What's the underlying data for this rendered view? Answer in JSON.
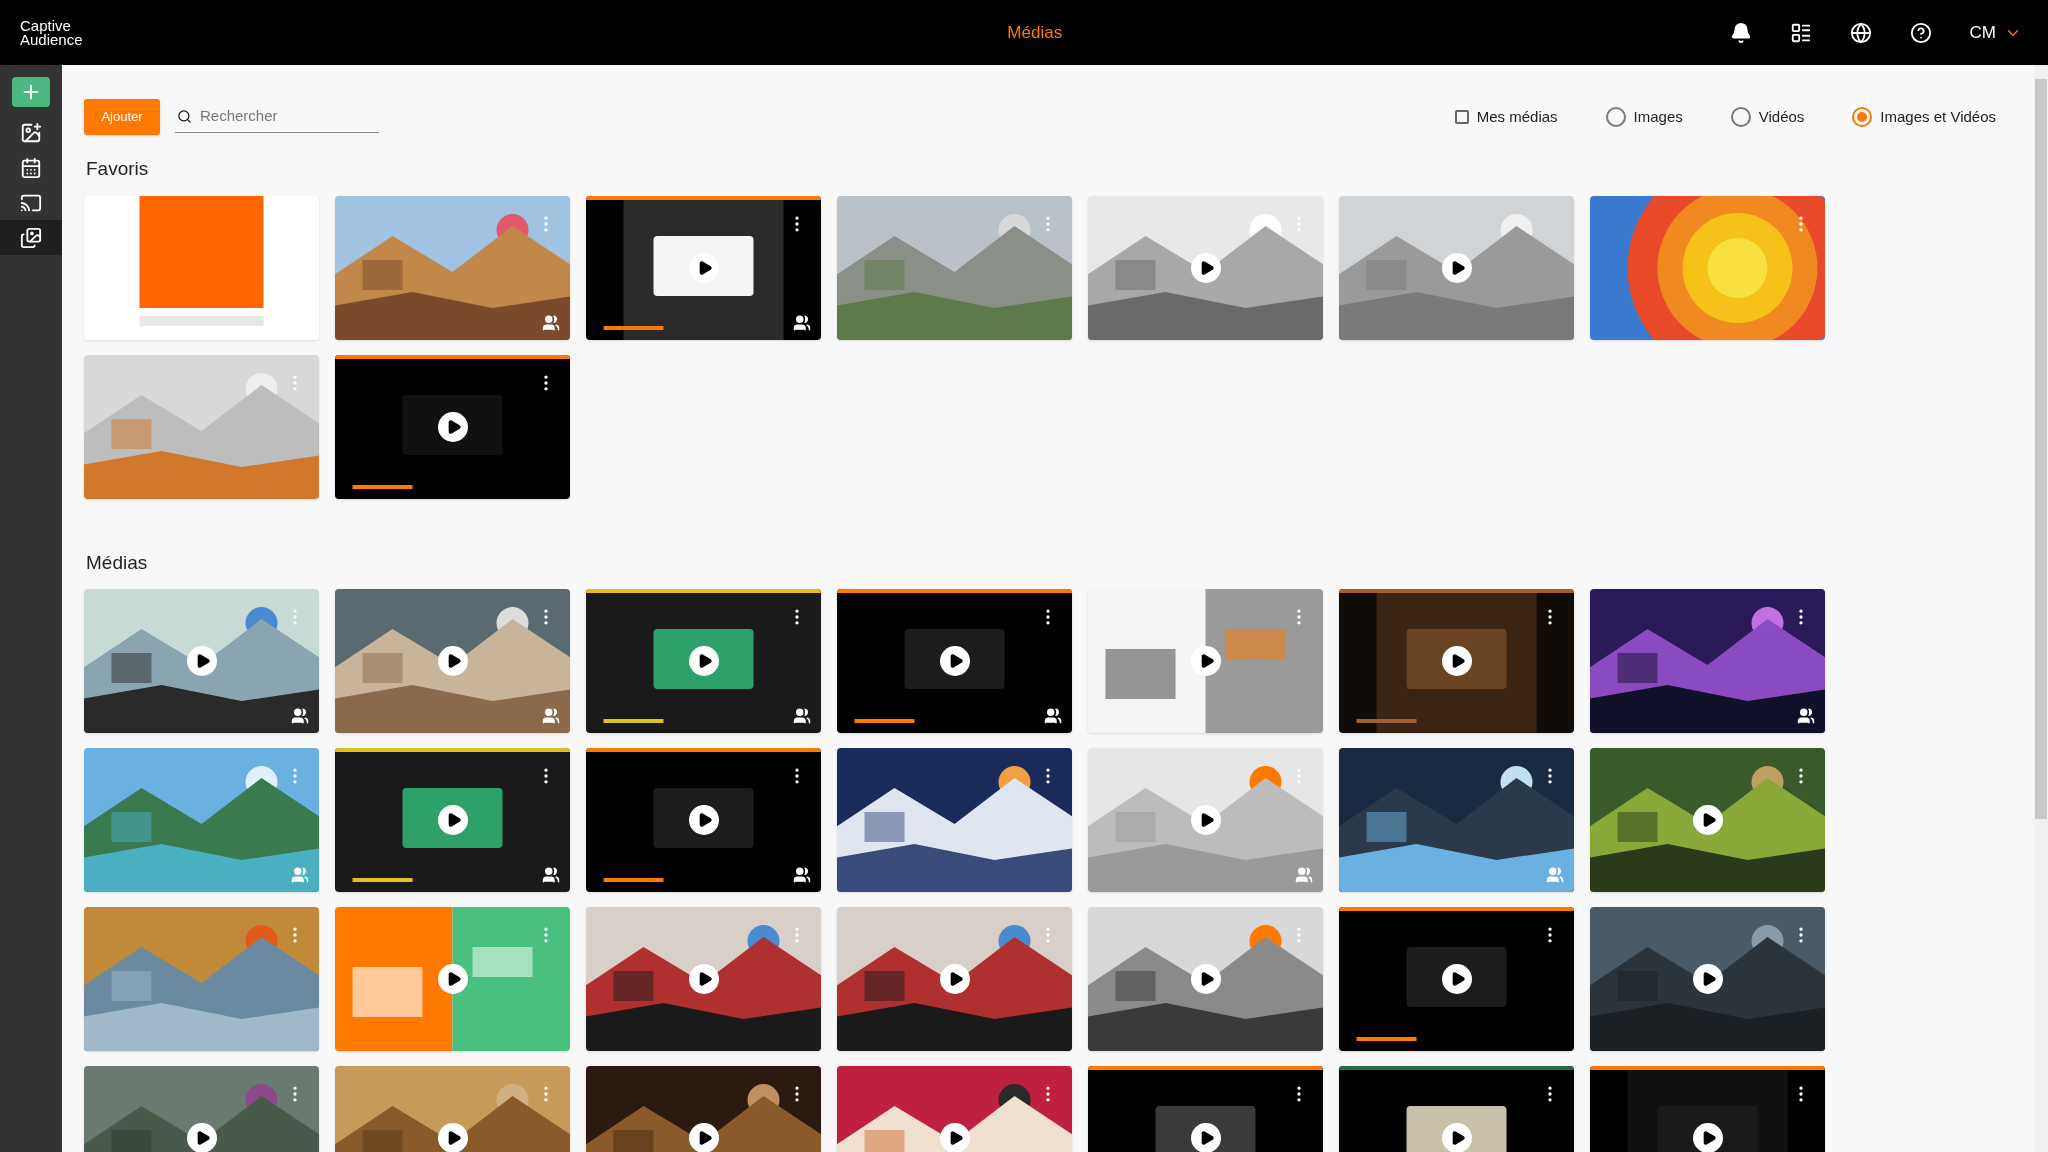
{
  "header": {
    "logo_lines": [
      "Captive",
      "Audience"
    ],
    "title": "Médias",
    "user": "CM"
  },
  "sidebar": {
    "items": [
      {
        "kind": "add",
        "selected": false
      },
      {
        "kind": "layouts",
        "selected": false
      },
      {
        "kind": "schedule",
        "selected": false
      },
      {
        "kind": "cast",
        "selected": false
      },
      {
        "kind": "media",
        "selected": true
      }
    ]
  },
  "toolbar": {
    "add_button": "Ajouter",
    "search": {
      "placeholder": "Rechercher"
    },
    "filters": [
      {
        "kind": "checkbox",
        "label": "Mes médias",
        "checked": false
      },
      {
        "kind": "radio",
        "label": "Images",
        "selected": false
      },
      {
        "kind": "radio",
        "label": "Vidéos",
        "selected": false
      },
      {
        "kind": "radio",
        "label": "Images et Vidéos",
        "selected": true
      }
    ]
  },
  "sections": [
    {
      "title": "Favoris",
      "items": [
        {
          "kind": "picture",
          "video": false,
          "shared": false,
          "menu": false
        },
        {
          "kind": "picture",
          "video": false,
          "shared": true,
          "menu": true
        },
        {
          "kind": "picture",
          "video": true,
          "shared": true,
          "menu": true
        },
        {
          "kind": "picture",
          "video": false,
          "shared": false,
          "menu": true
        },
        {
          "kind": "picture",
          "video": true,
          "shared": false,
          "menu": true
        },
        {
          "kind": "picture",
          "video": true,
          "shared": false,
          "menu": false
        },
        {
          "kind": "picture",
          "video": false,
          "shared": false,
          "menu": true
        },
        {
          "kind": "picture",
          "video": false,
          "shared": false,
          "menu": true
        },
        {
          "kind": "picture",
          "video": true,
          "shared": false,
          "menu": true
        }
      ]
    },
    {
      "title": "Médias",
      "items": [
        {
          "kind": "picture",
          "video": true,
          "shared": true,
          "menu": true
        },
        {
          "kind": "picture",
          "video": true,
          "shared": true,
          "menu": true
        },
        {
          "kind": "picture",
          "video": true,
          "shared": true,
          "menu": true
        },
        {
          "kind": "picture",
          "video": true,
          "shared": true,
          "menu": true
        },
        {
          "kind": "picture",
          "video": true,
          "shared": false,
          "menu": true
        },
        {
          "kind": "picture",
          "video": true,
          "shared": false,
          "menu": true
        },
        {
          "kind": "picture",
          "video": false,
          "shared": true,
          "menu": true
        },
        {
          "kind": "picture",
          "video": false,
          "shared": true,
          "menu": true
        },
        {
          "kind": "picture",
          "video": true,
          "shared": true,
          "menu": true
        },
        {
          "kind": "picture",
          "video": true,
          "shared": true,
          "menu": true
        },
        {
          "kind": "picture",
          "video": false,
          "shared": false,
          "menu": true
        },
        {
          "kind": "picture",
          "video": true,
          "shared": true,
          "menu": true
        },
        {
          "kind": "picture",
          "video": false,
          "shared": true,
          "menu": true
        },
        {
          "kind": "picture",
          "video": true,
          "shared": false,
          "menu": true
        },
        {
          "kind": "picture",
          "video": false,
          "shared": false,
          "menu": true
        },
        {
          "kind": "picture",
          "video": true,
          "shared": false,
          "menu": true
        },
        {
          "kind": "picture",
          "video": true,
          "shared": false,
          "menu": true
        },
        {
          "kind": "picture",
          "video": true,
          "shared": false,
          "menu": true
        },
        {
          "kind": "picture",
          "video": true,
          "shared": false,
          "menu": true
        },
        {
          "kind": "picture",
          "video": true,
          "shared": false,
          "menu": true
        },
        {
          "kind": "picture",
          "video": true,
          "shared": false,
          "menu": true
        },
        {
          "kind": "picture",
          "video": true,
          "shared": false,
          "menu": true
        },
        {
          "kind": "picture",
          "video": true,
          "shared": false,
          "menu": true
        },
        {
          "kind": "picture",
          "video": true,
          "shared": false,
          "menu": true
        },
        {
          "kind": "picture",
          "video": true,
          "shared": false,
          "menu": true
        },
        {
          "kind": "picture",
          "video": true,
          "shared": false,
          "menu": true
        },
        {
          "kind": "picture",
          "video": true,
          "shared": false,
          "menu": true
        },
        {
          "kind": "picture",
          "video": true,
          "shared": false,
          "menu": true
        }
      ]
    }
  ]
}
